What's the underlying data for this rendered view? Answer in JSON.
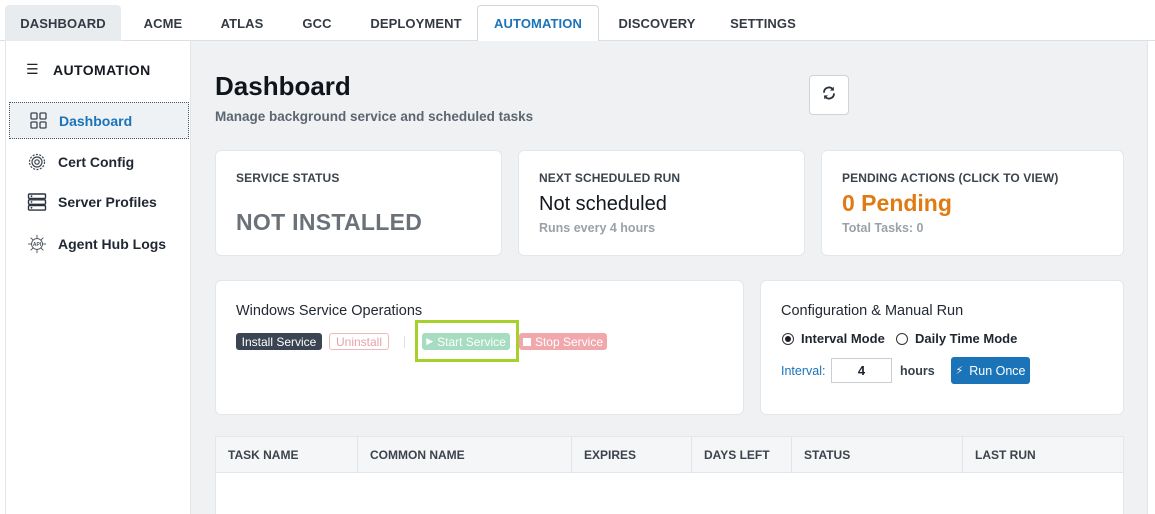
{
  "top_tabs": [
    {
      "label": "DASHBOARD"
    },
    {
      "label": "ACME"
    },
    {
      "label": "ATLAS"
    },
    {
      "label": "GCC"
    },
    {
      "label": "DEPLOYMENT"
    },
    {
      "label": "AUTOMATION",
      "active": true
    },
    {
      "label": "DISCOVERY"
    },
    {
      "label": "SETTINGS"
    }
  ],
  "sidebar": {
    "title": "AUTOMATION",
    "menu_icon": "hamburger-icon",
    "items": [
      {
        "label": "Dashboard",
        "icon": "grid-icon",
        "active": true
      },
      {
        "label": "Cert Config",
        "icon": "gear-icon"
      },
      {
        "label": "Server Profiles",
        "icon": "server-icon"
      },
      {
        "label": "Agent Hub Logs",
        "icon": "api-icon"
      }
    ]
  },
  "header": {
    "title": "Dashboard",
    "subtitle": "Manage background service and scheduled tasks",
    "refresh_icon": "refresh-icon"
  },
  "stats": {
    "service_status": {
      "label": "SERVICE STATUS",
      "value": "NOT INSTALLED"
    },
    "next_run": {
      "label": "NEXT SCHEDULED RUN",
      "value": "Not scheduled",
      "sub": "Runs every 4 hours"
    },
    "pending": {
      "label": "PENDING ACTIONS (CLICK TO VIEW)",
      "value": "0 Pending",
      "sub": "Total Tasks: 0"
    }
  },
  "service_ops": {
    "title": "Windows Service Operations",
    "install_label": "Install Service",
    "uninstall_label": "Uninstall",
    "start_label": "Start Service",
    "stop_label": "Stop Service",
    "start_icon": "play-icon",
    "stop_icon": "stop-icon"
  },
  "config": {
    "title": "Configuration & Manual Run",
    "mode_interval": "Interval Mode",
    "mode_daily": "Daily Time Mode",
    "selected_mode": "Interval Mode",
    "interval_label": "Interval:",
    "interval_value": "4",
    "hours_label": "hours",
    "run_once_label": "Run Once",
    "run_once_icon": "bolt-icon"
  },
  "table": {
    "columns": [
      "TASK NAME",
      "COMMON NAME",
      "EXPIRES",
      "DAYS LEFT",
      "STATUS",
      "LAST RUN"
    ],
    "rows": []
  },
  "colors": {
    "accent": "#1b73b8",
    "pending_orange": "#e07b14",
    "highlight": "#a6d12b",
    "start_green": "#a6dcbf",
    "stop_red": "#f1a8ad"
  }
}
